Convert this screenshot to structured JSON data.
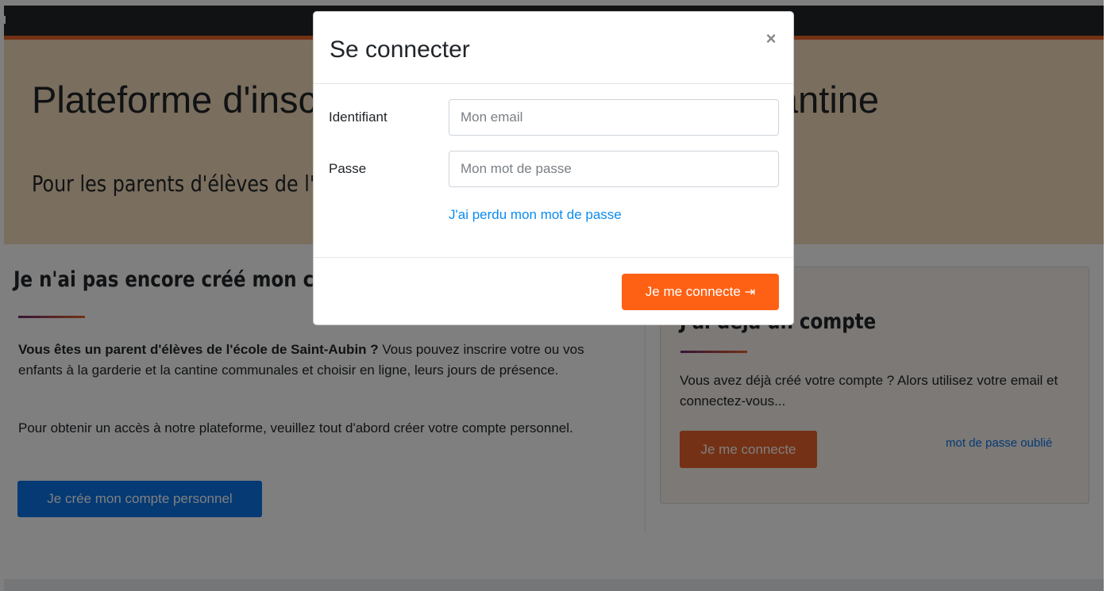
{
  "hero": {
    "title": "Plateforme d'inscription à la garderie et à la cantine",
    "subtitle": "Pour les parents d'élèves de l'école de Saint-Aubin"
  },
  "signup": {
    "title": "Je n'ai pas encore créé mon compte",
    "para1_bold": "Vous êtes un parent d'élèves de l'école de Saint-Aubin ?",
    "para1_rest": " Vous pouvez inscrire votre ou vos enfants à la garderie et la cantine communales et choisir en ligne, leurs jours de présence.",
    "para2": "Pour obtenir un accès à notre plateforme, veuillez tout d'abord créer votre compte personnel.",
    "button": "Je crée mon compte personnel"
  },
  "account_card": {
    "title": "J'ai déjà un compte",
    "text": "Vous avez déjà créé votre compte ? Alors utilisez votre email et connectez-vous...",
    "button": "Je me connecte",
    "forgot_link": "mot de passe oublié"
  },
  "modal": {
    "title": "Se connecter",
    "close_symbol": "×",
    "identifiant_label": "Identifiant",
    "identifiant_placeholder": "Mon email",
    "identifiant_value": "",
    "password_label": "Passe",
    "password_placeholder": "Mon mot de passe",
    "password_value": "",
    "forgot_link": "J'ai perdu mon mot de passe",
    "submit": "Je me connecte",
    "submit_icon": "sign-in-icon"
  },
  "colors": {
    "accent": "#e8622a",
    "submit": "#ff6114",
    "primary": "#0a74e9",
    "link": "#0a8cf0",
    "hero_background": "#f4dcbc",
    "topbar": "#222426"
  }
}
